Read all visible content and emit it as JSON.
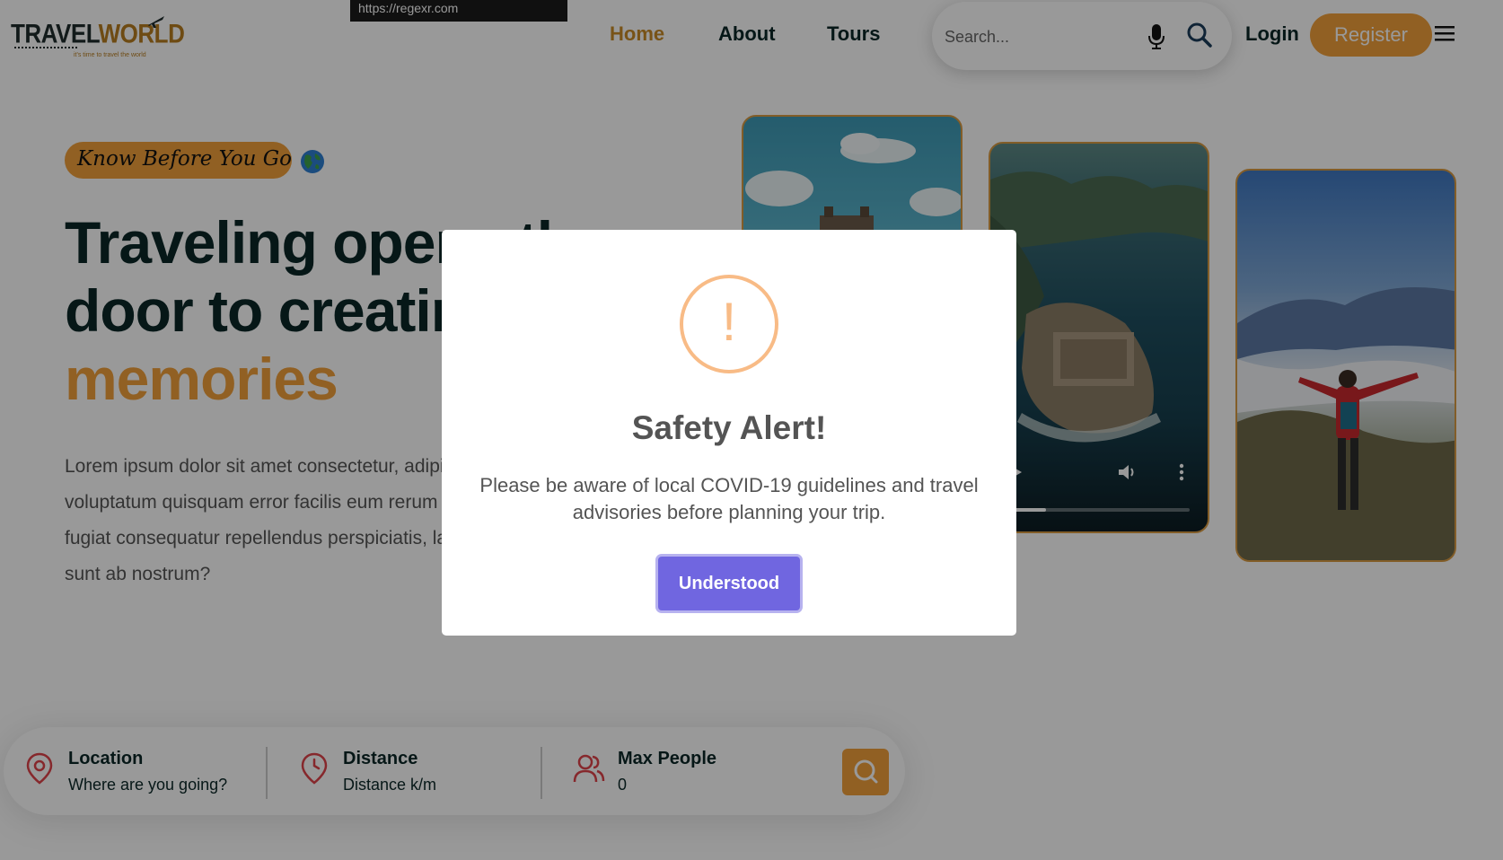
{
  "header": {
    "logo": {
      "part1": "TRAVEL",
      "part2": "WORLD",
      "tagline": "it's time to travel the world"
    },
    "url_tooltip": "https://regexr.com",
    "nav": {
      "home": "Home",
      "about": "About",
      "tours": "Tours"
    },
    "search": {
      "placeholder": "Search..."
    },
    "login": "Login",
    "register": "Register"
  },
  "hero": {
    "subtitle": "Know Before You Go",
    "title_line1": "Traveling opens the",
    "title_line2": "door to creating",
    "title_highlight": "memories",
    "description": "Lorem ipsum dolor sit amet consectetur, adipisicing elit. Ullam voluptatum quisquam error facilis eum rerum sint nihil iste molestias fugiat consequatur repellendus perspiciatis, laborum dolor! Eligendi sunt ab nostrum?"
  },
  "finder": {
    "location": {
      "label": "Location",
      "placeholder": "Where are you going?"
    },
    "distance": {
      "label": "Distance",
      "placeholder": "Distance k/m"
    },
    "people": {
      "label": "Max People",
      "placeholder": "0"
    }
  },
  "modal": {
    "icon": "!",
    "title": "Safety Alert!",
    "text": "Please be aware of local COVID-19 guidelines and travel advisories before planning your trip.",
    "button": "Understood"
  },
  "colors": {
    "accent": "#f2a13b",
    "heading": "#0b2727",
    "modal_button": "#7066e0",
    "warning": "#f8bb86"
  }
}
